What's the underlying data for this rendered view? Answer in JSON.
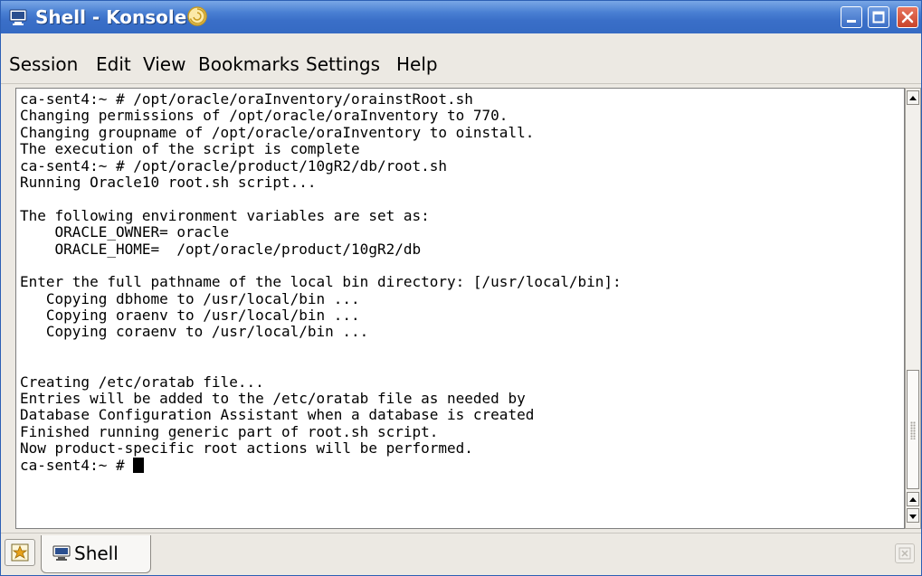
{
  "window": {
    "title": "Shell - Konsole"
  },
  "menu": [
    "Session",
    "Edit",
    "View",
    "Bookmarks",
    "Settings",
    "Help"
  ],
  "terminal": {
    "lines": [
      "ca-sent4:~ # /opt/oracle/oraInventory/orainstRoot.sh",
      "Changing permissions of /opt/oracle/oraInventory to 770.",
      "Changing groupname of /opt/oracle/oraInventory to oinstall.",
      "The execution of the script is complete",
      "ca-sent4:~ # /opt/oracle/product/10gR2/db/root.sh",
      "Running Oracle10 root.sh script...",
      "",
      "The following environment variables are set as:",
      "    ORACLE_OWNER= oracle",
      "    ORACLE_HOME=  /opt/oracle/product/10gR2/db",
      "",
      "Enter the full pathname of the local bin directory: [/usr/local/bin]:",
      "   Copying dbhome to /usr/local/bin ...",
      "   Copying oraenv to /usr/local/bin ...",
      "   Copying coraenv to /usr/local/bin ...",
      "",
      "",
      "Creating /etc/oratab file...",
      "Entries will be added to the /etc/oratab file as needed by",
      "Database Configuration Assistant when a database is created",
      "Finished running generic part of root.sh script.",
      "Now product-specific root actions will be performed."
    ],
    "prompt": "ca-sent4:~ # "
  },
  "tabs": [
    {
      "label": "Shell"
    }
  ],
  "icons": {
    "app": "terminal-icon",
    "title_decoration": "konsole-shell-icon",
    "new_session": "new-session-icon",
    "tab": "terminal-icon",
    "close_tab": "close-tab-icon"
  },
  "colors": {
    "titlebar": "#3a6fc8",
    "titlebar_text": "#ffffff",
    "terminal_bg": "#ffffff",
    "terminal_fg": "#000000",
    "chrome": "#ece9e3"
  }
}
